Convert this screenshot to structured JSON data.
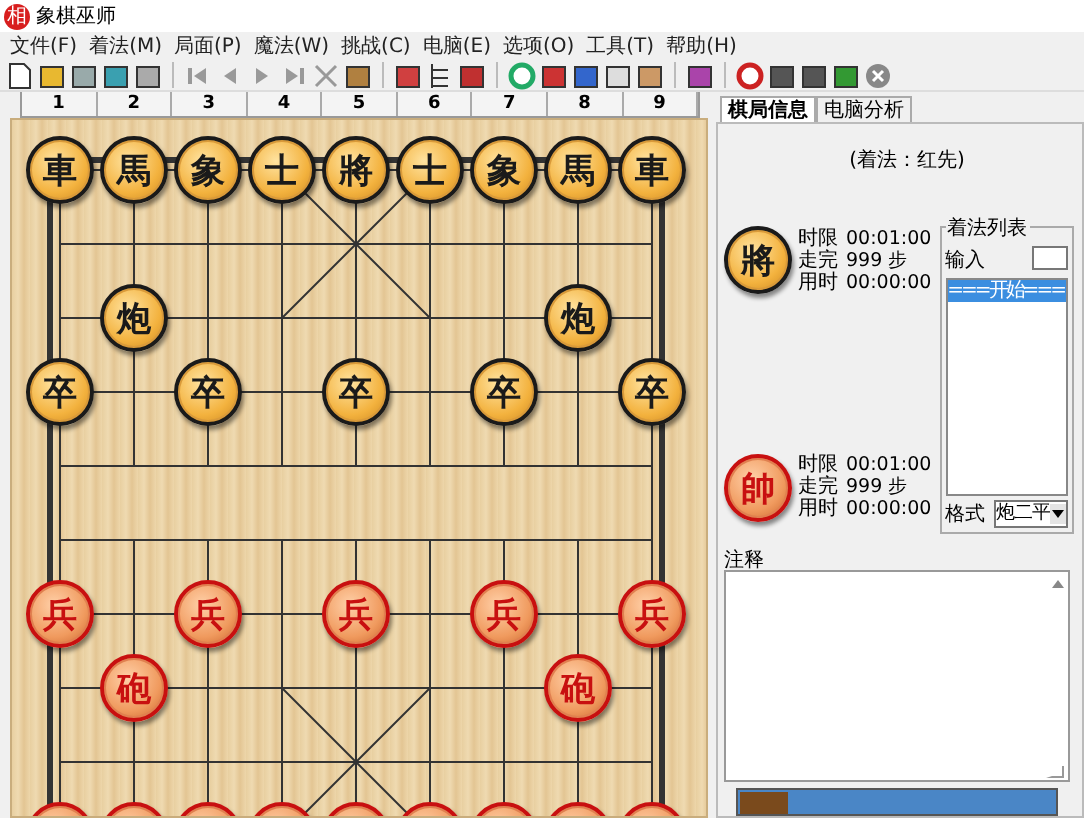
{
  "window": {
    "app_icon_text": "相",
    "title": "象棋巫师"
  },
  "menu": [
    "文件(F)",
    "着法(M)",
    "局面(P)",
    "魔法(W)",
    "挑战(C)",
    "电脑(E)",
    "选项(O)",
    "工具(T)",
    "帮助(H)"
  ],
  "ruler": [
    "1",
    "2",
    "3",
    "4",
    "5",
    "6",
    "7",
    "8",
    "9"
  ],
  "board": {
    "ranks": [
      [
        {
          "kind": "piece",
          "label": "車",
          "color": "#1a1a1a"
        },
        {
          "kind": "piece",
          "label": "馬",
          "color": "#1a1a1a"
        },
        {
          "kind": "piece",
          "label": "象",
          "color": "#1a1a1a"
        },
        {
          "kind": "piece",
          "label": "士",
          "color": "#1a1a1a"
        },
        {
          "kind": "piece",
          "label": "將",
          "color": "#1a1a1a"
        },
        {
          "kind": "piece",
          "label": "士",
          "color": "#1a1a1a"
        },
        {
          "kind": "piece",
          "label": "象",
          "color": "#1a1a1a"
        },
        {
          "kind": "piece",
          "label": "馬",
          "color": "#1a1a1a"
        },
        {
          "kind": "piece",
          "label": "車",
          "color": "#1a1a1a"
        }
      ],
      [
        {
          "kind": "empty"
        },
        {
          "kind": "empty"
        },
        {
          "kind": "empty"
        },
        {
          "kind": "empty"
        },
        {
          "kind": "empty"
        },
        {
          "kind": "empty"
        },
        {
          "kind": "empty"
        },
        {
          "kind": "empty"
        },
        {
          "kind": "empty"
        }
      ],
      [
        {
          "kind": "empty"
        },
        {
          "kind": "piece",
          "label": "炮",
          "color": "#1a1a1a"
        },
        {
          "kind": "empty"
        },
        {
          "kind": "empty"
        },
        {
          "kind": "empty"
        },
        {
          "kind": "empty"
        },
        {
          "kind": "empty"
        },
        {
          "kind": "piece",
          "label": "炮",
          "color": "#1a1a1a"
        },
        {
          "kind": "empty"
        }
      ],
      [
        {
          "kind": "piece",
          "label": "卒",
          "color": "#1a1a1a"
        },
        {
          "kind": "empty"
        },
        {
          "kind": "piece",
          "label": "卒",
          "color": "#1a1a1a"
        },
        {
          "kind": "empty"
        },
        {
          "kind": "piece",
          "label": "卒",
          "color": "#1a1a1a"
        },
        {
          "kind": "empty"
        },
        {
          "kind": "piece",
          "label": "卒",
          "color": "#1a1a1a"
        },
        {
          "kind": "empty"
        },
        {
          "kind": "piece",
          "label": "卒",
          "color": "#1a1a1a"
        }
      ],
      [
        {
          "kind": "empty"
        },
        {
          "kind": "empty"
        },
        {
          "kind": "empty"
        },
        {
          "kind": "empty"
        },
        {
          "kind": "empty"
        },
        {
          "kind": "empty"
        },
        {
          "kind": "empty"
        },
        {
          "kind": "empty"
        },
        {
          "kind": "empty"
        }
      ],
      [
        {
          "kind": "empty"
        },
        {
          "kind": "empty"
        },
        {
          "kind": "empty"
        },
        {
          "kind": "empty"
        },
        {
          "kind": "empty"
        },
        {
          "kind": "empty"
        },
        {
          "kind": "empty"
        },
        {
          "kind": "empty"
        },
        {
          "kind": "empty"
        }
      ],
      [
        {
          "kind": "piece",
          "label": "兵",
          "color": "#c81010"
        },
        {
          "kind": "empty"
        },
        {
          "kind": "piece",
          "label": "兵",
          "color": "#c81010"
        },
        {
          "kind": "empty"
        },
        {
          "kind": "piece",
          "label": "兵",
          "color": "#c81010"
        },
        {
          "kind": "empty"
        },
        {
          "kind": "piece",
          "label": "兵",
          "color": "#c81010"
        },
        {
          "kind": "empty"
        },
        {
          "kind": "piece",
          "label": "兵",
          "color": "#c81010"
        }
      ],
      [
        {
          "kind": "empty"
        },
        {
          "kind": "piece",
          "label": "砲",
          "color": "#c81010"
        },
        {
          "kind": "empty"
        },
        {
          "kind": "empty"
        },
        {
          "kind": "empty"
        },
        {
          "kind": "empty"
        },
        {
          "kind": "empty"
        },
        {
          "kind": "piece",
          "label": "砲",
          "color": "#c81010"
        },
        {
          "kind": "empty"
        }
      ],
      [
        {
          "kind": "empty"
        },
        {
          "kind": "empty"
        },
        {
          "kind": "empty"
        },
        {
          "kind": "empty"
        },
        {
          "kind": "empty"
        },
        {
          "kind": "empty"
        },
        {
          "kind": "empty"
        },
        {
          "kind": "empty"
        },
        {
          "kind": "empty"
        }
      ],
      [
        {
          "kind": "piece",
          "color": "#c81010"
        },
        {
          "kind": "piece",
          "color": "#c81010"
        },
        {
          "kind": "piece",
          "color": "#c81010"
        },
        {
          "kind": "piece",
          "color": "#c81010"
        },
        {
          "kind": "piece",
          "color": "#c81010"
        },
        {
          "kind": "piece",
          "color": "#c81010"
        },
        {
          "kind": "piece",
          "color": "#c81010"
        },
        {
          "kind": "piece",
          "color": "#c81010"
        },
        {
          "kind": "piece",
          "color": "#c81010"
        }
      ]
    ]
  },
  "tabs": [
    {
      "label": "棋局信息",
      "selected": true
    },
    {
      "label": "电脑分析",
      "selected": false
    }
  ],
  "move_order": "(着法：红先)",
  "players": [
    {
      "piece": "將",
      "color": "#1a1a1a",
      "lines": [
        {
          "label": "时限",
          "value": "00:01:00"
        },
        {
          "label": "走完",
          "value": "999 步"
        },
        {
          "label": "用时",
          "value": "00:00:00"
        }
      ]
    },
    {
      "piece": "帥",
      "color": "#c81010",
      "lines": [
        {
          "label": "时限",
          "value": "00:01:00"
        },
        {
          "label": "走完",
          "value": "999 步"
        },
        {
          "label": "用时",
          "value": "00:00:00"
        }
      ]
    }
  ],
  "move_list": {
    "title": "着法列表",
    "input_label": "输入",
    "items": [
      {
        "text": "===开始===",
        "selected": true
      }
    ],
    "format_label": "格式",
    "format_value": "炮二平"
  },
  "notes": {
    "label": "注释"
  }
}
